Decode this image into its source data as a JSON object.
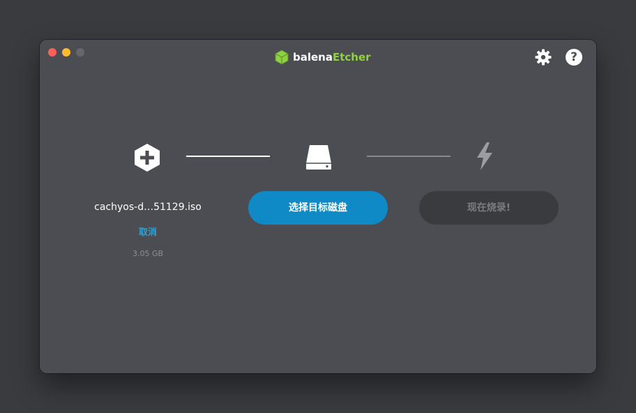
{
  "window": {
    "brand_part1": "balena",
    "brand_part2": "Etcher"
  },
  "top_icons": {
    "help_glyph": "?"
  },
  "source": {
    "filename": "cachyos-d…51129.iso",
    "cancel_label": "取消",
    "size": "3.05 GB"
  },
  "target": {
    "button_label": "选择目标磁盘"
  },
  "flash": {
    "button_label": "现在烧录!"
  },
  "colors": {
    "background": "#3a3b3e",
    "window": "#4c4d53",
    "accent_blue": "#0f8ac6",
    "link_blue": "#2aa2d8",
    "brand_green": "#8fd144"
  }
}
